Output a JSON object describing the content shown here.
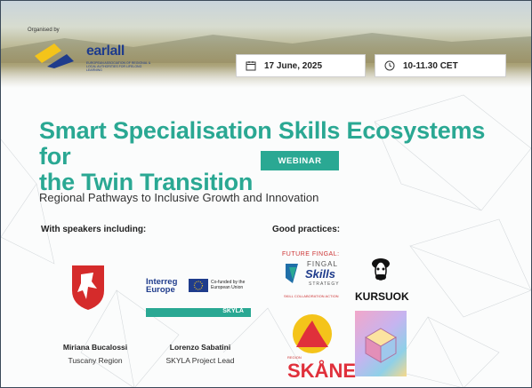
{
  "header": {
    "organised_by": "Organised by",
    "org_name": "earlall",
    "org_subtitle": "EUROPEAN ASSOCIATION OF REGIONAL & LOCAL AUTHORITIES FOR LIFELONG LEARNING"
  },
  "event": {
    "date": "17 June, 2025",
    "time": "10-11.30 CET",
    "title_line1": "Smart Specialisation Skills Ecosystems for",
    "title_line2": "the Twin Transition",
    "badge": "WEBINAR",
    "subtitle": "Regional Pathways to Inclusive Growth and Innovation"
  },
  "speakers": {
    "label": "With speakers including:",
    "items": [
      {
        "name": "Miriana Bucalossi",
        "role": "Tuscany Region"
      },
      {
        "name": "Lorenzo Sabatini",
        "role": "SKYLA Project Lead"
      }
    ],
    "interreg_line1": "Interreg",
    "interreg_line2": "Europe",
    "cofunded": "Co-funded by the European Union",
    "skyla": "SKYLA"
  },
  "practices": {
    "label": "Good practices:",
    "fingal_line1": "FUTURE FINGAL:",
    "fingal_line2": "FINGAL",
    "fingal_line3": "Skills",
    "fingal_line4": "STRATEGY",
    "fingal_line5": "SKILL COLLABORATION ACTION",
    "kursuok": "KURSUOK",
    "skane": "SKÅNE",
    "skane_small": "REGION"
  },
  "colors": {
    "accent": "#2aa893",
    "brand_blue": "#1f3c8c",
    "brand_yellow": "#f4c41a"
  }
}
